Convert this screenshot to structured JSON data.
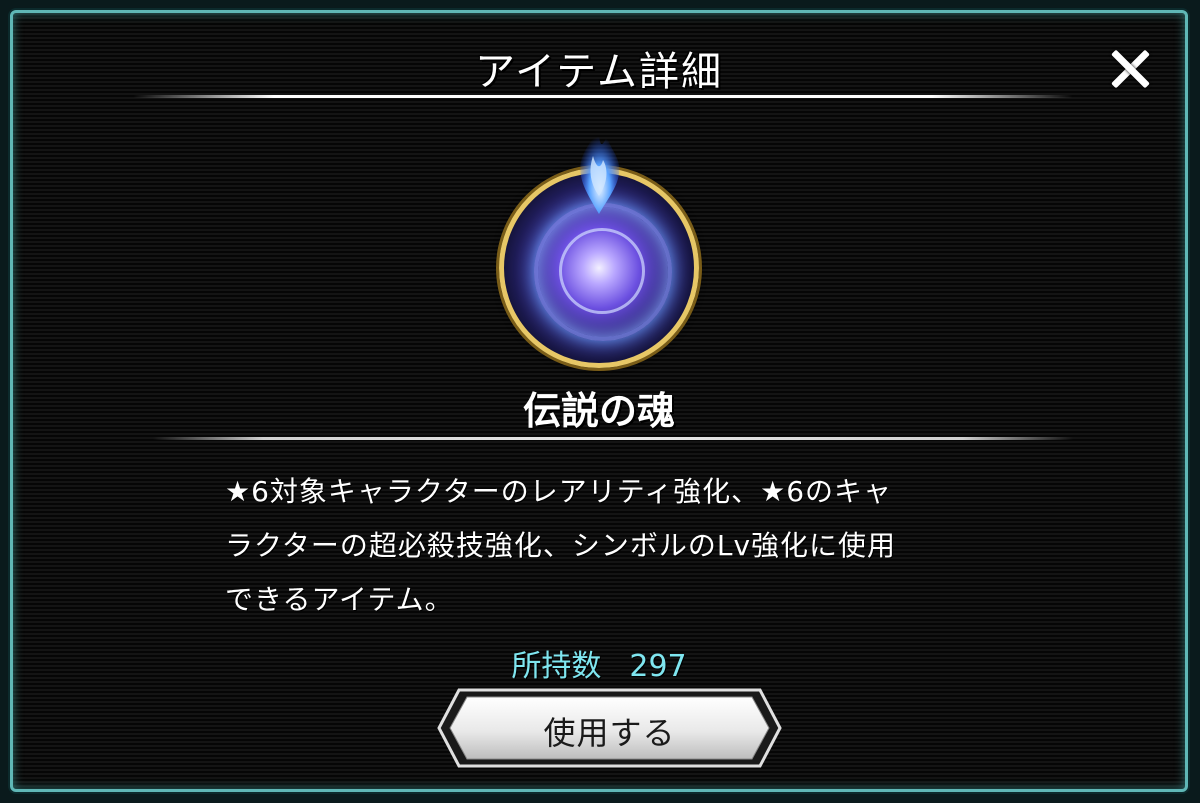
{
  "dialog": {
    "title": "アイテム詳細",
    "close_icon": "close-icon"
  },
  "item": {
    "icon": "legendary-soul-orb-icon",
    "name": "伝説の魂",
    "description_lines": [
      "★6対象キャラクターのレアリティ強化、★6のキャ",
      "ラクターの超必殺技強化、シンボルのLv強化に使用",
      "できるアイテム。"
    ],
    "count_label": "所持数",
    "count_value": "297"
  },
  "actions": {
    "use_label": "使用する"
  },
  "colors": {
    "frame": "#5fb7b6",
    "count_text": "#7fe6f0",
    "ring_gold": "#e7c766"
  }
}
